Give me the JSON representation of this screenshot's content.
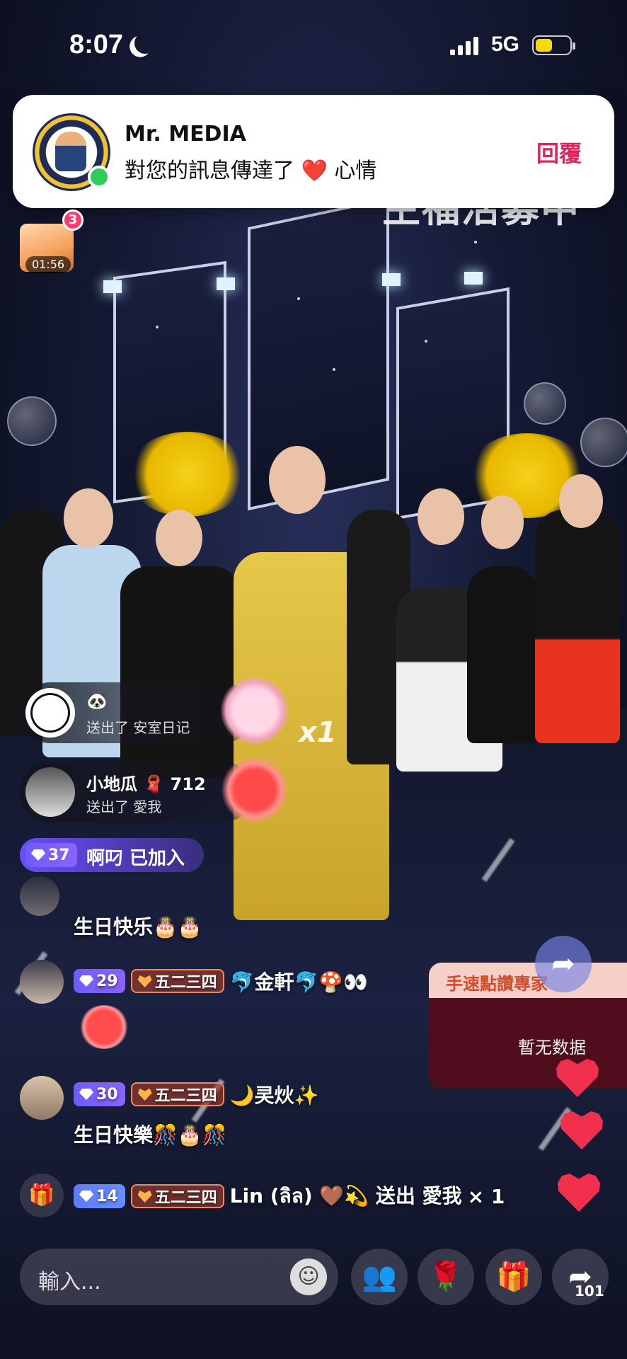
{
  "status_bar": {
    "time": "8:07",
    "network": "5G"
  },
  "notification": {
    "sender": "Mr. MEDIA",
    "message": "對您的訊息傳達了 ❤️ 心情",
    "reply_label": "回覆"
  },
  "treasure_box": {
    "badge": "3",
    "timer": "01:56"
  },
  "gifts": [
    {
      "name": "🐼",
      "action": "送出了 安室日记"
    },
    {
      "name": "小地瓜 🧣 712",
      "action": "送出了 愛我"
    }
  ],
  "gift_multiplier": "x1",
  "joined": {
    "level": "37",
    "text": "啊叼 已加入"
  },
  "chat": [
    {
      "text": "生日快乐🎂🎂"
    },
    {
      "level": "29",
      "fan_badge": "五二三四",
      "user": "🐬金軒🐬🍄👀"
    },
    {
      "level": "30",
      "fan_badge": "五二三四",
      "user": "🌙㚑炏✨",
      "text": "生日快樂🎊🎂🎊"
    },
    {
      "level": "14",
      "fan_badge": "五二三四",
      "user": "Lin (ลิล) 🤎💫 送出 愛我",
      "count": "× 1"
    }
  ],
  "ranking": {
    "title": "手速點讚專家",
    "empty": "暫无数据"
  },
  "input": {
    "placeholder": "輸入..."
  },
  "share_count": "101",
  "colors": {
    "reply": "#e0245e",
    "heart": "#f0304d",
    "level": "#6e5cf8",
    "battery": "#f5d90a"
  }
}
